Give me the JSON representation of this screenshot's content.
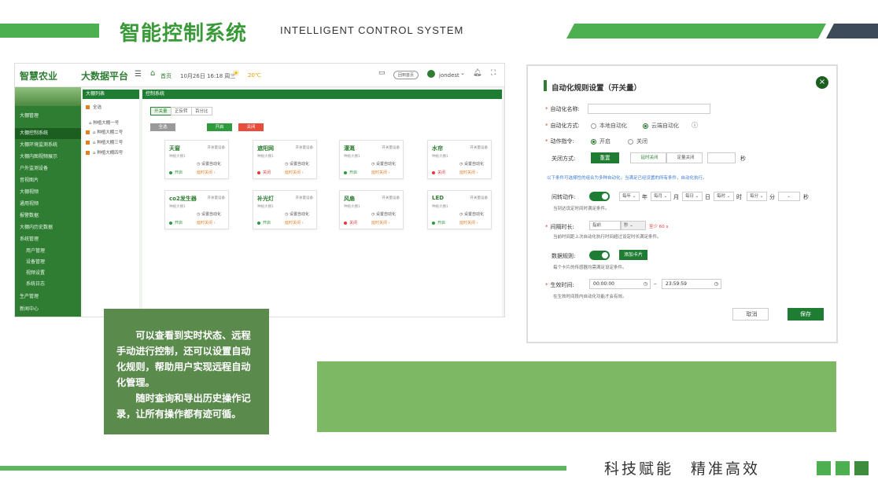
{
  "header": {
    "title": "智能控制系统",
    "subtitle": "INTELLIGENT  CONTROL  SYSTEM"
  },
  "shot1": {
    "logo": "智慧农业",
    "platform": "大数据平台",
    "home": "首页",
    "date": "10月26日 16:18 周三",
    "weather": "20℃",
    "back_button": "回到首页",
    "user": "jondest",
    "sidebar": [
      "大棚管理",
      "大棚控制系统",
      "大棚环境监测系统",
      "大棚内图视频展示",
      "户外监测设备",
      "音视图片",
      "大棚视频",
      "通用视频",
      "报警数据",
      "大棚内历史数据",
      "系统管理",
      "用户管理",
      "设备管理",
      "视频设置",
      "系统日志",
      "生产管理",
      "新闻中心"
    ],
    "list_header": "大棚列表",
    "list_items": [
      "全选",
      "种植大棚一号",
      "种植大棚二号",
      "种植大棚三号",
      "种植大棚四号"
    ],
    "main_header": "控制系统",
    "tabs": [
      "开关量",
      "正反转",
      "百分比"
    ],
    "buttons": {
      "all": "全选",
      "open": "开启",
      "close": "关闭"
    },
    "cards": [
      {
        "name": "天窗",
        "type": "开关量设备",
        "line1": "种植大棚1",
        "auto": "设置自动化",
        "status": "开启",
        "delay": "延时关闭",
        "on": true
      },
      {
        "name": "遮阳网",
        "type": "开关量设备",
        "line1": "种植大棚1",
        "auto": "设置自动化",
        "status": "关闭",
        "delay": "延时关闭",
        "on": false
      },
      {
        "name": "灌溉",
        "type": "开关量设备",
        "line1": "种植大棚1",
        "auto": "设置自动化",
        "status": "开启",
        "delay": "延时关闭",
        "on": true
      },
      {
        "name": "水帘",
        "type": "开关量设备",
        "line1": "种植大棚1",
        "auto": "设置自动化",
        "status": "关闭",
        "delay": "延时关闭",
        "on": false
      },
      {
        "name": "co2发生器",
        "type": "开关量设备",
        "line1": "种植大棚1",
        "auto": "设置自动化",
        "status": "开启",
        "delay": "延时关闭",
        "on": true
      },
      {
        "name": "补光灯",
        "type": "开关量设备",
        "line1": "种植大棚1",
        "auto": "设置自动化",
        "status": "开启",
        "delay": "延时关闭",
        "on": true
      },
      {
        "name": "风扇",
        "type": "开关量设备",
        "line1": "种植大棚1",
        "auto": "设置自动化",
        "status": "关闭",
        "delay": "延时关闭",
        "on": false
      },
      {
        "name": "LED",
        "type": "开关量设备",
        "line1": "种植大棚1",
        "auto": "设置自动化",
        "status": "开启",
        "delay": "延时关闭",
        "on": true
      }
    ]
  },
  "description": {
    "p1": "可以查看到实时状态、远程手动进行控制，还可以设置自动化规则，帮助用户实现远程自动化管理。",
    "p2": "随时查询和导出历史操作记录，让所有操作都有迹可循。"
  },
  "dialog": {
    "title": "自动化规则设置（开关量）",
    "name_label": "自动化名称:",
    "mode_label": "自动化方式:",
    "mode_local": "本地自动化",
    "mode_cloud": "云端自动化",
    "cmd_label": "动作指令:",
    "cmd_on": "开启",
    "cmd_off": "关闭",
    "close_mode_label": "关闭方式:",
    "reset": "重置",
    "delay_close": "延时关闭",
    "timed_close": "定量关闭",
    "sec": "秒",
    "info": "以下条件可选择性的组合为多种自动化，当满足已经设置的所有条件，自动化执行。",
    "cycle_label": "间转动作:",
    "cycle_selects": [
      "每年",
      "每月",
      "每日",
      "每时",
      "每分"
    ],
    "cycle_units": [
      "年",
      "月",
      "日",
      "时",
      "分",
      "秒"
    ],
    "cycle_hint": "当到达设定时间时满足条件。",
    "interval_label": "间隔时长:",
    "interval_value": "指前",
    "interval_unit": "秒",
    "interval_warn": "至少 60 s",
    "interval_hint": "当前时间距上次自动化执行时间超过设定时长满足条件。",
    "data_label": "数据规则:",
    "add_card": "添加卡片",
    "data_hint": "每个卡片的传感器均需满足设定条件。",
    "time_label": "生效时间:",
    "time_start": "00:00:00",
    "time_end": "23:59:59",
    "time_hint": "在生效时间段内自动化功能才会有效。",
    "cancel": "取消",
    "save": "保存"
  },
  "footer": {
    "slogan": "科技赋能　精准高效"
  }
}
